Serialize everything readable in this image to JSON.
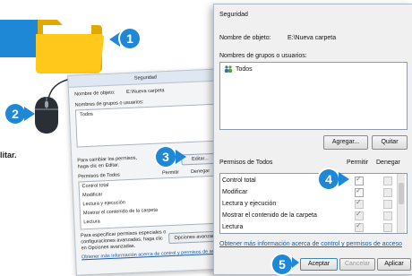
{
  "steps": {
    "one": "1",
    "two": "2",
    "three": "3",
    "four": "4",
    "five": "5"
  },
  "cut_text": "litar.",
  "back_dialog": {
    "tab": "Seguridad",
    "object_name_label": "Nombre de objeto:",
    "object_name_value": "E:\\Nueva carpeta",
    "groups_label": "Nombres de grupos o usuarios:",
    "group_item": "Todos",
    "change_perms_text_1": "Para cambiar los permisos,",
    "change_perms_text_2": "haga clic en Editar.",
    "edit_button": "Editar...",
    "permissions_label": "Permisos de Todos",
    "allow_col": "Permitir",
    "deny_col": "Denegar",
    "permissions": [
      "Control total",
      "Modificar",
      "Lectura y ejecución",
      "Mostrar el contenido de la carpeta",
      "Lectura"
    ],
    "advanced_text_1": "Para especificar permisos especiales o",
    "advanced_text_2": "configuraciones avanzadas, haga clic",
    "advanced_text_3": "en Opciones avanzadas.",
    "advanced_button": "Opciones avanzadas",
    "link_text": "Obtener más información acerca de control y permisos de acceso"
  },
  "front_dialog": {
    "tab": "Seguridad",
    "object_name_label": "Nombre de objeto:",
    "object_name_value": "E:\\Nueva carpeta",
    "groups_label": "Nombres de grupos o usuarios:",
    "group_item": "Todos",
    "add_button": "Agregar...",
    "remove_button": "Quitar",
    "permissions_label": "Permisos de Todos",
    "allow_col": "Permitir",
    "deny_col": "Denegar",
    "permissions": [
      {
        "name": "Control total",
        "allow": true,
        "deny": false
      },
      {
        "name": "Modificar",
        "allow": true,
        "deny": false
      },
      {
        "name": "Lectura y ejecución",
        "allow": true,
        "deny": false
      },
      {
        "name": "Mostrar el contenido de la carpeta",
        "allow": true,
        "deny": false
      },
      {
        "name": "Lectura",
        "allow": true,
        "deny": false
      }
    ],
    "link_text": "Obtener más información acerca de control y permisos de acceso",
    "accept_button": "Aceptar",
    "cancel_button": "Cancelar",
    "apply_button": "Aplicar"
  },
  "colors": {
    "accent": "#1e88d6",
    "folder": "#f6c400"
  },
  "icons": [
    "folder-icon",
    "mouse-icon",
    "users-icon"
  ]
}
